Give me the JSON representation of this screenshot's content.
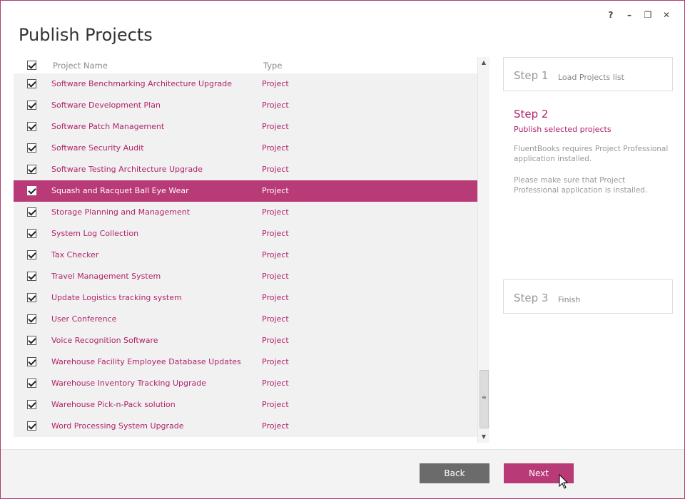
{
  "window": {
    "controls": {
      "help": "?",
      "minimize": "–",
      "restore": "❐",
      "close": "✕"
    },
    "title": "Publish Projects"
  },
  "list": {
    "columns": {
      "name": "Project Name",
      "type": "Type"
    },
    "rows": [
      {
        "name": "Software Benchmarking Architecture Upgrade",
        "type": "Project",
        "checked": true,
        "selected": false
      },
      {
        "name": "Software Development Plan",
        "type": "Project",
        "checked": true,
        "selected": false
      },
      {
        "name": "Software Patch Management",
        "type": "Project",
        "checked": true,
        "selected": false
      },
      {
        "name": "Software Security Audit",
        "type": "Project",
        "checked": true,
        "selected": false
      },
      {
        "name": "Software Testing Architecture Upgrade",
        "type": "Project",
        "checked": true,
        "selected": false
      },
      {
        "name": "Squash and Racquet Ball Eye Wear",
        "type": "Project",
        "checked": true,
        "selected": true
      },
      {
        "name": "Storage Planning and Management",
        "type": "Project",
        "checked": true,
        "selected": false
      },
      {
        "name": "System Log Collection",
        "type": "Project",
        "checked": true,
        "selected": false
      },
      {
        "name": "Tax Checker",
        "type": "Project",
        "checked": true,
        "selected": false
      },
      {
        "name": "Travel Management System",
        "type": "Project",
        "checked": true,
        "selected": false
      },
      {
        "name": "Update Logistics tracking system",
        "type": "Project",
        "checked": true,
        "selected": false
      },
      {
        "name": "User Conference",
        "type": "Project",
        "checked": true,
        "selected": false
      },
      {
        "name": "Voice Recognition Software",
        "type": "Project",
        "checked": true,
        "selected": false
      },
      {
        "name": "Warehouse Facility Employee Database Updates",
        "type": "Project",
        "checked": true,
        "selected": false
      },
      {
        "name": "Warehouse Inventory Tracking Upgrade",
        "type": "Project",
        "checked": true,
        "selected": false
      },
      {
        "name": "Warehouse Pick-n-Pack solution",
        "type": "Project",
        "checked": true,
        "selected": false
      },
      {
        "name": "Word Processing System Upgrade",
        "type": "Project",
        "checked": true,
        "selected": false
      }
    ]
  },
  "steps": {
    "step1": {
      "number": "Step 1",
      "label": "Load Projects list"
    },
    "step2": {
      "number": "Step 2",
      "label": "Publish selected projects",
      "message1": "FluentBooks requires Project Professional application installed.",
      "message2": "Please make sure that Project Professional application is installed."
    },
    "step3": {
      "number": "Step 3",
      "label": "Finish"
    }
  },
  "footer": {
    "back_label": "Back",
    "next_label": "Next"
  },
  "colors": {
    "accent": "#b83a76",
    "text_accent": "#b0246b",
    "back_button": "#6b6b6b"
  }
}
